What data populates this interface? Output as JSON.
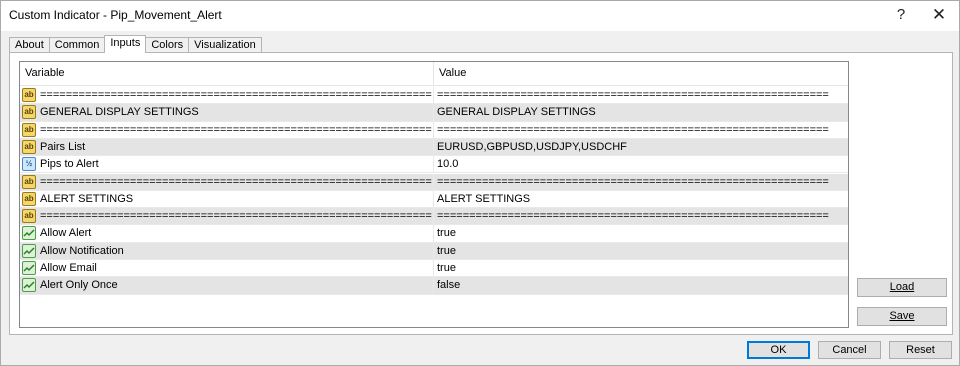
{
  "window": {
    "title": "Custom Indicator - Pip_Movement_Alert",
    "help_glyph": "?",
    "close_glyph": "✕"
  },
  "tabs": [
    "About",
    "Common",
    "Inputs",
    "Colors",
    "Visualization"
  ],
  "active_tab": "Inputs",
  "grid": {
    "columns": [
      "Variable",
      "Value"
    ],
    "rows": [
      {
        "type": "ab",
        "variable": "=============================================================",
        "value": "============================================================="
      },
      {
        "type": "ab",
        "variable": "GENERAL  DISPLAY  SETTINGS",
        "value": "GENERAL  DISPLAY  SETTINGS"
      },
      {
        "type": "ab",
        "variable": "=============================================================",
        "value": "============================================================="
      },
      {
        "type": "ab",
        "variable": "Pairs List",
        "value": "EURUSD,GBPUSD,USDJPY,USDCHF"
      },
      {
        "type": "num",
        "variable": "Pips to Alert",
        "value": "10.0"
      },
      {
        "type": "ab",
        "variable": "=============================================================",
        "value": "============================================================="
      },
      {
        "type": "ab",
        "variable": "ALERT  SETTINGS",
        "value": "ALERT  SETTINGS"
      },
      {
        "type": "ab",
        "variable": "=============================================================",
        "value": "============================================================="
      },
      {
        "type": "bool",
        "variable": "Allow Alert",
        "value": "true"
      },
      {
        "type": "bool",
        "variable": "Allow Notification",
        "value": "true"
      },
      {
        "type": "bool",
        "variable": "Allow Email",
        "value": "true"
      },
      {
        "type": "bool",
        "variable": "Alert Only Once",
        "value": "false"
      }
    ]
  },
  "icons": {
    "ab": "ab",
    "num": "½"
  },
  "buttons": {
    "load": "Load",
    "save": "Save",
    "ok": "OK",
    "cancel": "Cancel",
    "reset": "Reset"
  }
}
